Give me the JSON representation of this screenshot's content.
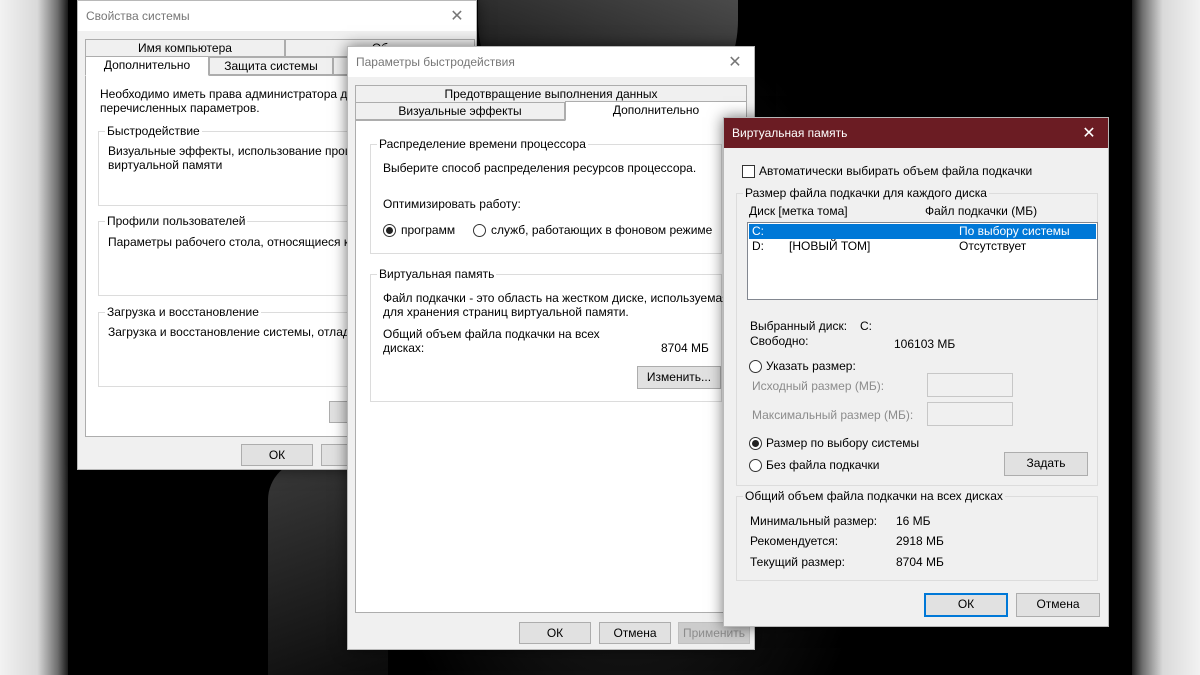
{
  "sys_props": {
    "title": "Свойства системы",
    "tabs_row1": [
      "Имя компьютера",
      "Об"
    ],
    "tabs_row2": [
      "Дополнительно",
      "Защита системы",
      "Уд"
    ],
    "admin_note": [
      "Необходимо иметь права администратора для из",
      "перечисленных параметров."
    ],
    "perf": {
      "legend": "Быстродействие",
      "text": [
        "Визуальные эффекты, использование процессо",
        "виртуальной памяти"
      ]
    },
    "profiles": {
      "legend": "Профили пользователей",
      "text": "Параметры рабочего стола, относящиеся ко вхо"
    },
    "startup": {
      "legend": "Загрузка и восстановление",
      "text": "Загрузка и восстановление системы, отладочна"
    },
    "params_button": "Пе",
    "ok": "ОК",
    "cancel": "От"
  },
  "perf_options": {
    "title": "Параметры быстродействия",
    "tab_dep": "Предотвращение выполнения данных",
    "tab_visual": "Визуальные эффекты",
    "tab_advanced": "Дополнительно",
    "cpu": {
      "legend": "Распределение времени процессора",
      "desc": "Выберите способ распределения ресурсов процессора.",
      "optimize_label": "Оптимизировать работу:",
      "radio_programs": "программ",
      "radio_services": "служб, работающих в фоновом режиме",
      "selected": "программ"
    },
    "vm": {
      "legend": "Виртуальная память",
      "desc": [
        "Файл подкачки - это область на жестком диске, используемая",
        "для хранения страниц виртуальной памяти."
      ],
      "total_label": [
        "Общий объем файла подкачки на всех",
        "дисках:"
      ],
      "total_value": "8704 МБ",
      "change_button": "Изменить..."
    },
    "ok": "ОК",
    "cancel": "Отмена",
    "apply": "Применить"
  },
  "vm_dialog": {
    "title": "Виртуальная память",
    "auto_checkbox": "Автоматически выбирать объем файла подкачки",
    "auto_checked": false,
    "drives_legend": "Размер файла подкачки для каждого диска",
    "col_drive": "Диск [метка тома]",
    "col_file": "Файл подкачки (МБ)",
    "drives": [
      {
        "letter": "C:",
        "label": "",
        "file": "По выбору системы",
        "selected": true
      },
      {
        "letter": "D:",
        "label": "[НОВЫЙ ТОМ]",
        "file": "Отсутствует",
        "selected": false
      }
    ],
    "selected_drive_label": "Выбранный диск:",
    "selected_drive_value": "C:",
    "free_label": "Свободно:",
    "free_value": "106103 МБ",
    "radio_custom": "Указать размер:",
    "initial_label": "Исходный размер (МБ):",
    "max_label": "Максимальный размер (МБ):",
    "radio_system": "Размер по выбору системы",
    "radio_none": "Без файла подкачки",
    "selected_option": "Размер по выбору системы",
    "set_button": "Задать",
    "totals_legend": "Общий объем файла подкачки на всех дисках",
    "min_label": "Минимальный размер:",
    "min_value": "16 МБ",
    "rec_label": "Рекомендуется:",
    "rec_value": "2918 МБ",
    "cur_label": "Текущий размер:",
    "cur_value": "8704 МБ",
    "ok": "ОК",
    "cancel": "Отмена"
  }
}
